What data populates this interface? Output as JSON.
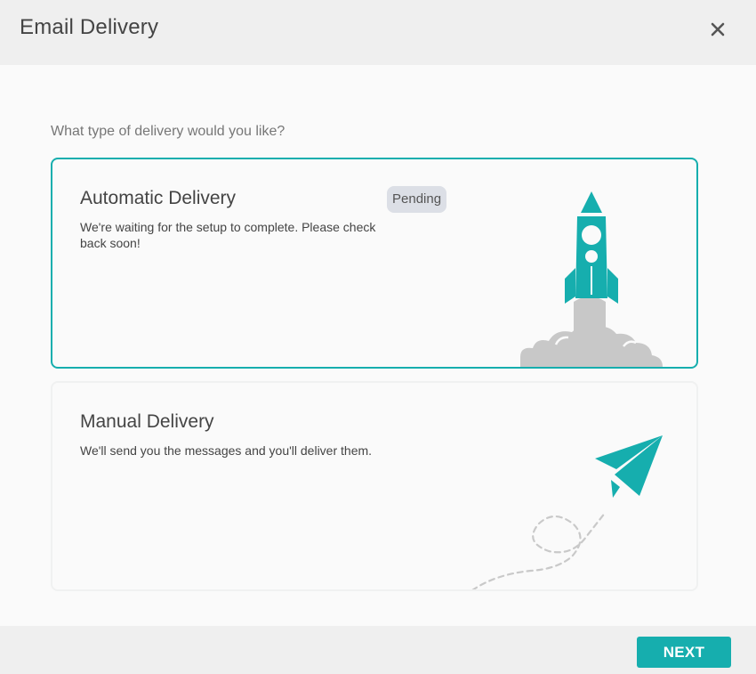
{
  "header": {
    "title": "Email Delivery",
    "close_icon": "close-icon"
  },
  "main": {
    "question": "What type of delivery would you like?",
    "options": [
      {
        "title": "Automatic Delivery",
        "badge": "Pending",
        "description": "We're waiting for the setup to complete. Please check back soon!",
        "icon": "rocket-icon",
        "selected": true
      },
      {
        "title": "Manual Delivery",
        "description": "We'll send you the messages and you'll deliver them.",
        "icon": "paper-plane-icon",
        "selected": false
      }
    ]
  },
  "footer": {
    "next_label": "NEXT"
  },
  "colors": {
    "accent": "#16aeae",
    "badge_bg": "#dcdfe6",
    "cloud": "#c8c8c8"
  }
}
